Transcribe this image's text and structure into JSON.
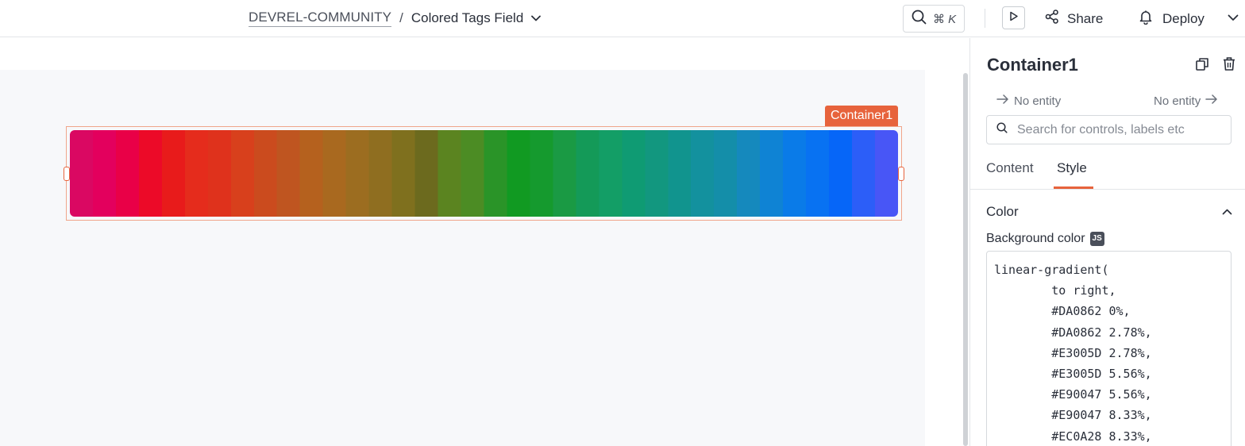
{
  "header": {
    "org": "DEVREL-COMMUNITY",
    "separator": "/",
    "page": "Colored Tags Field",
    "search_shortcut_symbol": "⌘",
    "search_shortcut_key": "K",
    "share_label": "Share",
    "deploy_label": "Deploy"
  },
  "canvas": {
    "selected_widget_label": "Container1",
    "gradient_direction": "to right"
  },
  "panel": {
    "title": "Container1",
    "entity_left": "No entity",
    "entity_right": "No entity",
    "search_placeholder": "Search for controls, labels etc",
    "tabs": [
      {
        "label": "Content",
        "active": false
      },
      {
        "label": "Style",
        "active": true
      }
    ],
    "section_title": "Color",
    "property_label": "Background color",
    "js_badge": "JS",
    "code_lines": [
      "linear-gradient(",
      "        to right,",
      "        #DA0862 0%,",
      "        #DA0862 2.78%,",
      "        #E3005D 2.78%,",
      "        #E3005D 5.56%,",
      "        #E90047 5.56%,",
      "        #E90047 8.33%,",
      "        #EC0A28 8.33%,"
    ]
  },
  "colors": {
    "accent": "#e7633c",
    "canvas_bg": "#f7f8fa",
    "text_primary": "#2a2f3a"
  }
}
